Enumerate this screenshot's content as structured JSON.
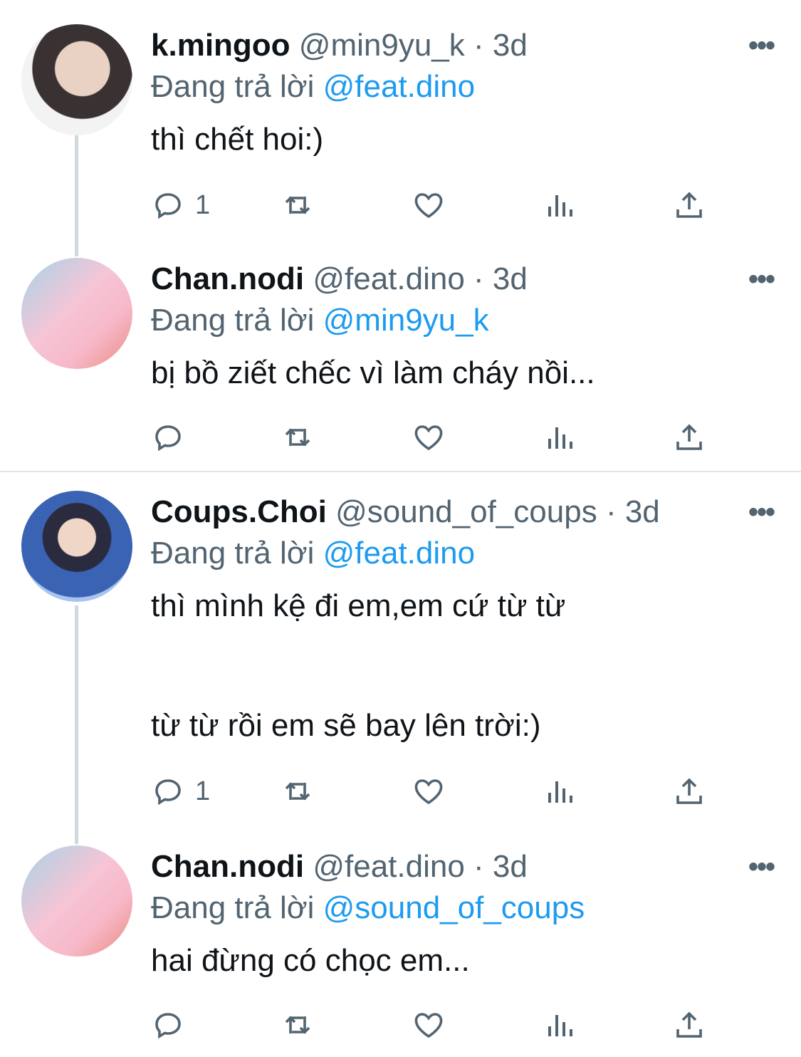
{
  "tweets": [
    {
      "name": "k.mingoo",
      "handle": "@min9yu_k",
      "sep": "·",
      "time": "3d",
      "reply_prefix": "Đang trả lời",
      "reply_to": "@feat.dino",
      "text": "thì chết hoi:)",
      "reply_count": "1"
    },
    {
      "name": "Chan.nodi",
      "handle": "@feat.dino",
      "sep": "·",
      "time": "3d",
      "reply_prefix": "Đang trả lời",
      "reply_to": "@min9yu_k",
      "text": "bị bồ ziết chếc vì làm cháy nồi...",
      "reply_count": ""
    },
    {
      "name": "Coups.Choi",
      "handle": "@sound_of_coups",
      "sep": "·",
      "time": "3d",
      "reply_prefix": "Đang trả lời",
      "reply_to": "@feat.dino",
      "text": "thì mình kệ đi em,em cứ từ từ\n\n\ntừ từ rồi em sẽ bay lên trời:)",
      "reply_count": "1"
    },
    {
      "name": "Chan.nodi",
      "handle": "@feat.dino",
      "sep": "·",
      "time": "3d",
      "reply_prefix": "Đang trả lời",
      "reply_to": "@sound_of_coups",
      "text": "hai đừng có chọc em...",
      "reply_count": ""
    }
  ],
  "icons": {
    "reply": "reply-icon",
    "retweet": "retweet-icon",
    "like": "heart-icon",
    "views": "views-icon",
    "share": "share-icon",
    "more": "more-icon"
  },
  "colors": {
    "link": "#1d9bf0",
    "muted": "#536471",
    "thread_line": "#cfd9de"
  }
}
